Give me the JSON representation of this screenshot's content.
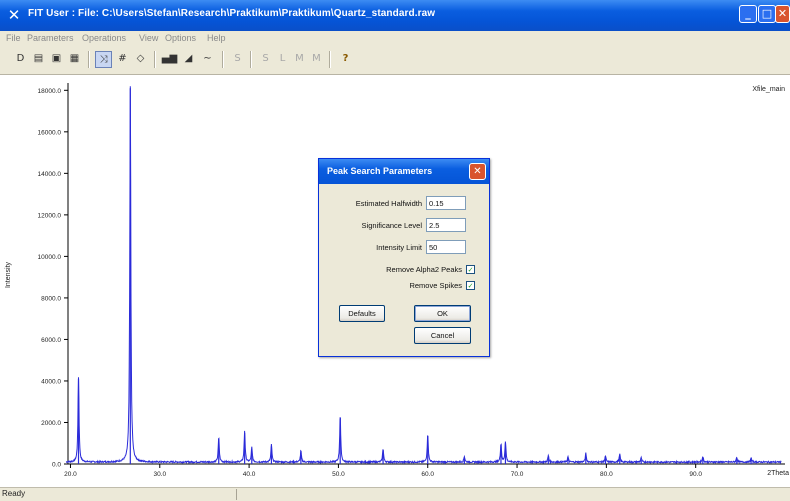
{
  "window": {
    "icon": "x-app-icon",
    "title": "FIT  User :    File: C:\\Users\\Stefan\\Research\\Praktikum\\Praktikum\\Quartz_standard.raw",
    "buttons": [
      "minimize-icon",
      "maximize-icon",
      "close-icon"
    ]
  },
  "menu": [
    "File",
    "Parameters",
    "Operations",
    "View",
    "Options",
    "Help"
  ],
  "toolbar": {
    "icons": [
      "new-icon",
      "open-icon",
      "save-icon",
      "print-icon",
      "cursor-peak-icon",
      "grid-icon",
      "zoom-icon",
      "bar-chart-icon",
      "profile-icon",
      "curve-icon",
      "s-icon",
      "s-icon",
      "l-icon",
      "m-icon",
      "m-icon",
      "help-icon"
    ],
    "glyphs": [
      "D",
      "▤",
      "▣",
      "▦",
      "⤨",
      "#",
      "◇",
      "▄▆",
      "◢",
      "∼",
      "S",
      "S",
      "L",
      "M",
      "M",
      "?"
    ]
  },
  "chart": {
    "corner_label": "Xfile_main",
    "ylabel": "Intensity",
    "yticks": [
      "0.0",
      "2000.0",
      "4000.0",
      "6000.0",
      "8000.0",
      "10000.0",
      "12000.0",
      "14000.0",
      "16000.0",
      "18000.0"
    ],
    "xticks": [
      "20.0",
      "30.0",
      "40.0",
      "50.0",
      "60.0",
      "70.0",
      "80.0",
      "90.0"
    ],
    "xlabel_end": "2Theta",
    "line_color": "#2b2bd9"
  },
  "chart_data": {
    "type": "line",
    "xlabel": "2Theta",
    "ylabel": "Intensity",
    "xlim": [
      19.5,
      100
    ],
    "ylim": [
      0,
      18400
    ],
    "grid": false,
    "peaks": [
      {
        "x": 20.9,
        "y": 4100
      },
      {
        "x": 26.7,
        "y": 18100
      },
      {
        "x": 36.6,
        "y": 1200
      },
      {
        "x": 39.5,
        "y": 1500
      },
      {
        "x": 40.3,
        "y": 700
      },
      {
        "x": 42.5,
        "y": 850
      },
      {
        "x": 45.8,
        "y": 550
      },
      {
        "x": 50.2,
        "y": 2250
      },
      {
        "x": 55.0,
        "y": 650
      },
      {
        "x": 60.0,
        "y": 1350
      },
      {
        "x": 64.1,
        "y": 280
      },
      {
        "x": 68.2,
        "y": 900
      },
      {
        "x": 68.7,
        "y": 1000
      },
      {
        "x": 73.5,
        "y": 320
      },
      {
        "x": 75.7,
        "y": 260
      },
      {
        "x": 77.7,
        "y": 420
      },
      {
        "x": 79.9,
        "y": 300
      },
      {
        "x": 81.5,
        "y": 380
      },
      {
        "x": 83.9,
        "y": 200
      },
      {
        "x": 90.8,
        "y": 280
      },
      {
        "x": 94.6,
        "y": 240
      },
      {
        "x": 96.2,
        "y": 210
      }
    ]
  },
  "dialog": {
    "title": "Peak Search Parameters",
    "fields": [
      {
        "label": "Estimated Halfwidth",
        "value": "0.15"
      },
      {
        "label": "Significance Level",
        "value": "2.5"
      },
      {
        "label": "Intensity Limit",
        "value": "50"
      }
    ],
    "checks": [
      {
        "label": "Remove Alpha2 Peaks",
        "checked": true,
        "mark": "✓"
      },
      {
        "label": "Remove Spikes",
        "checked": true,
        "mark": "✓"
      }
    ],
    "buttons": {
      "defaults": "Defaults",
      "ok": "OK",
      "cancel": "Cancel"
    },
    "close_glyph": "✕"
  },
  "status": {
    "text": "Ready"
  }
}
